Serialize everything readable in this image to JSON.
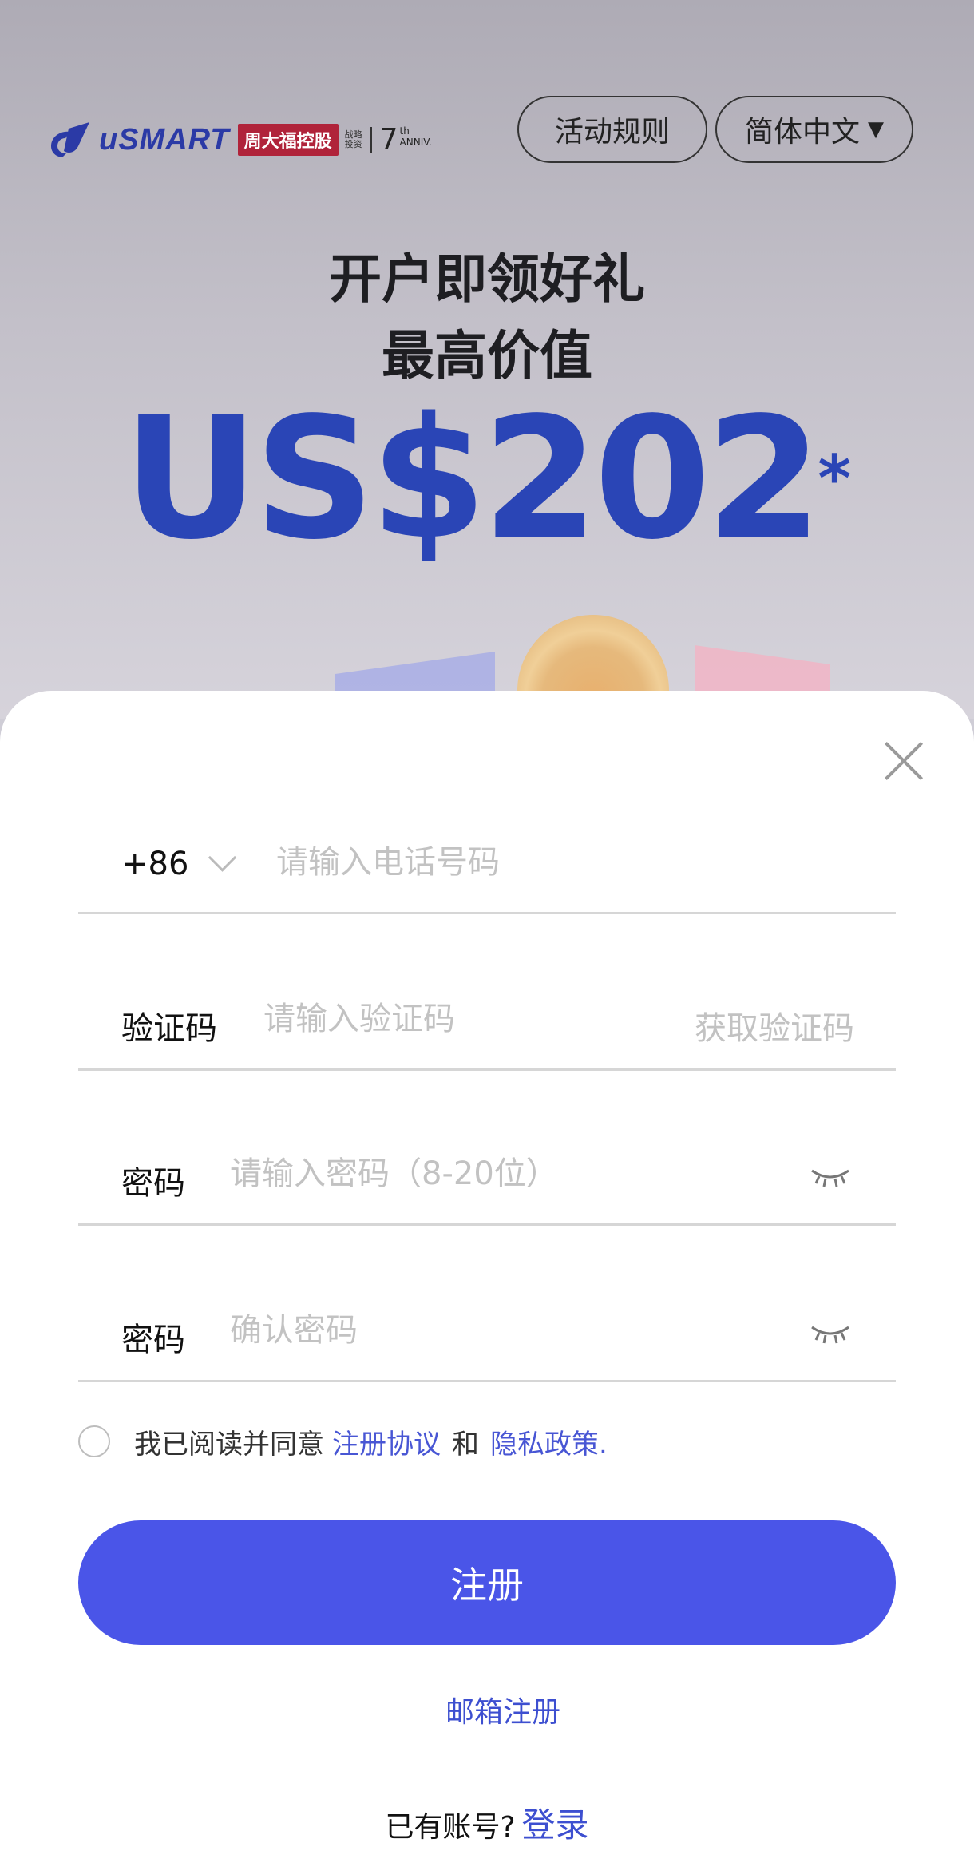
{
  "banner": {
    "logo_text": "uSMART",
    "logo_tag": "周大福控股",
    "logo_small_1": "战略",
    "logo_small_2": "投资",
    "anniv_num": "7",
    "anniv_sup": "th",
    "anniv_label": "ANNIV.",
    "rules_button": "活动规则",
    "language_select": "简体中文",
    "headline_1": "开户即领好礼",
    "headline_2": "最高价值",
    "amount": "US$202",
    "amount_mark": "*"
  },
  "form": {
    "country_code": "+86",
    "phone_placeholder": "请输入电话号码",
    "code_label": "验证码",
    "code_placeholder": "请输入验证码",
    "get_code": "获取验证码",
    "password_label": "密码",
    "password_placeholder": "请输入密码（8-20位）",
    "confirm_label": "密码",
    "confirm_placeholder": "确认密码"
  },
  "agreement": {
    "prefix": "我已阅读并同意",
    "terms_link": "注册协议",
    "and": "和",
    "privacy_link": "隐私政策."
  },
  "actions": {
    "submit": "注册",
    "email_register": "邮箱注册",
    "have_account": "已有账号?",
    "login": "登录"
  },
  "colors": {
    "accent": "#4a55e8",
    "link": "#3d4fd0",
    "amount": "#2a45b6",
    "brand_tag": "#b0233a"
  }
}
